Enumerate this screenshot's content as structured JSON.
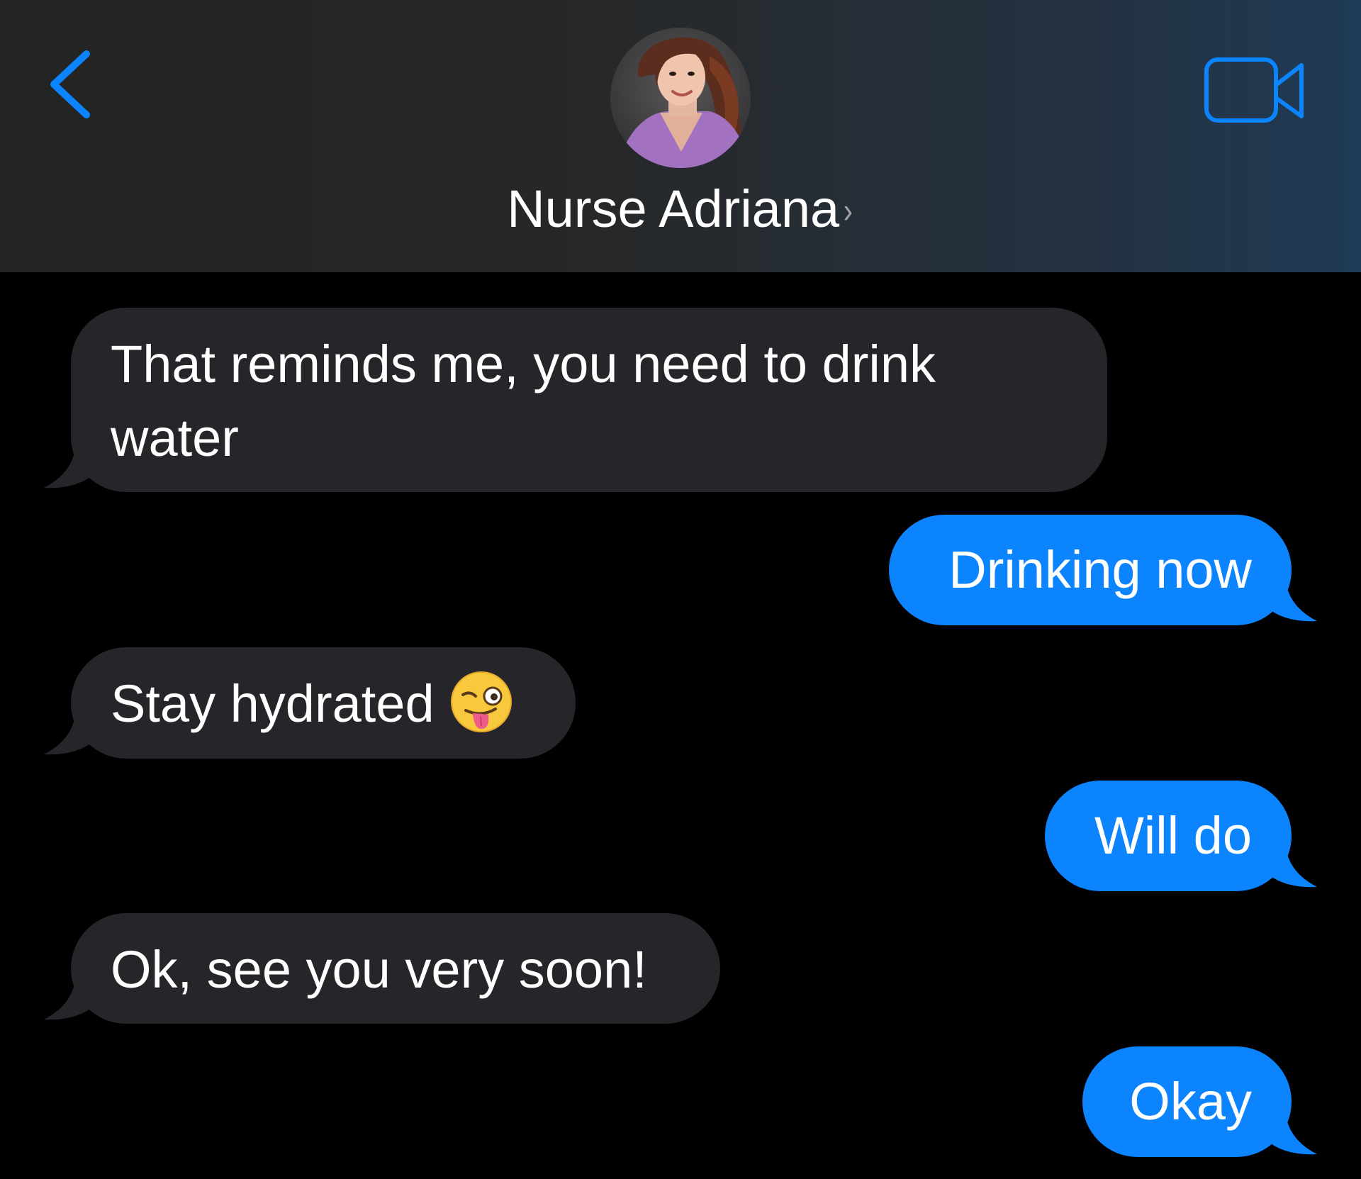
{
  "header": {
    "contact_name": "Nurse Adriana",
    "chevron": "›",
    "back_icon": "chevron-left-icon",
    "video_icon": "video-camera-icon"
  },
  "colors": {
    "accent": "#0b84fe",
    "incoming_bubble": "#26252a",
    "outgoing_bubble": "#0b84fe",
    "background": "#000000"
  },
  "messages": [
    {
      "direction": "incoming",
      "text": "That reminds me, you need to drink water"
    },
    {
      "direction": "outgoing",
      "text": "Drinking now"
    },
    {
      "direction": "incoming",
      "text": "Stay hydrated",
      "emoji": "winking-face-with-tongue-emoji"
    },
    {
      "direction": "outgoing",
      "text": "Will do"
    },
    {
      "direction": "incoming",
      "text": "Ok, see you very soon!"
    },
    {
      "direction": "outgoing",
      "text": "Okay"
    }
  ]
}
